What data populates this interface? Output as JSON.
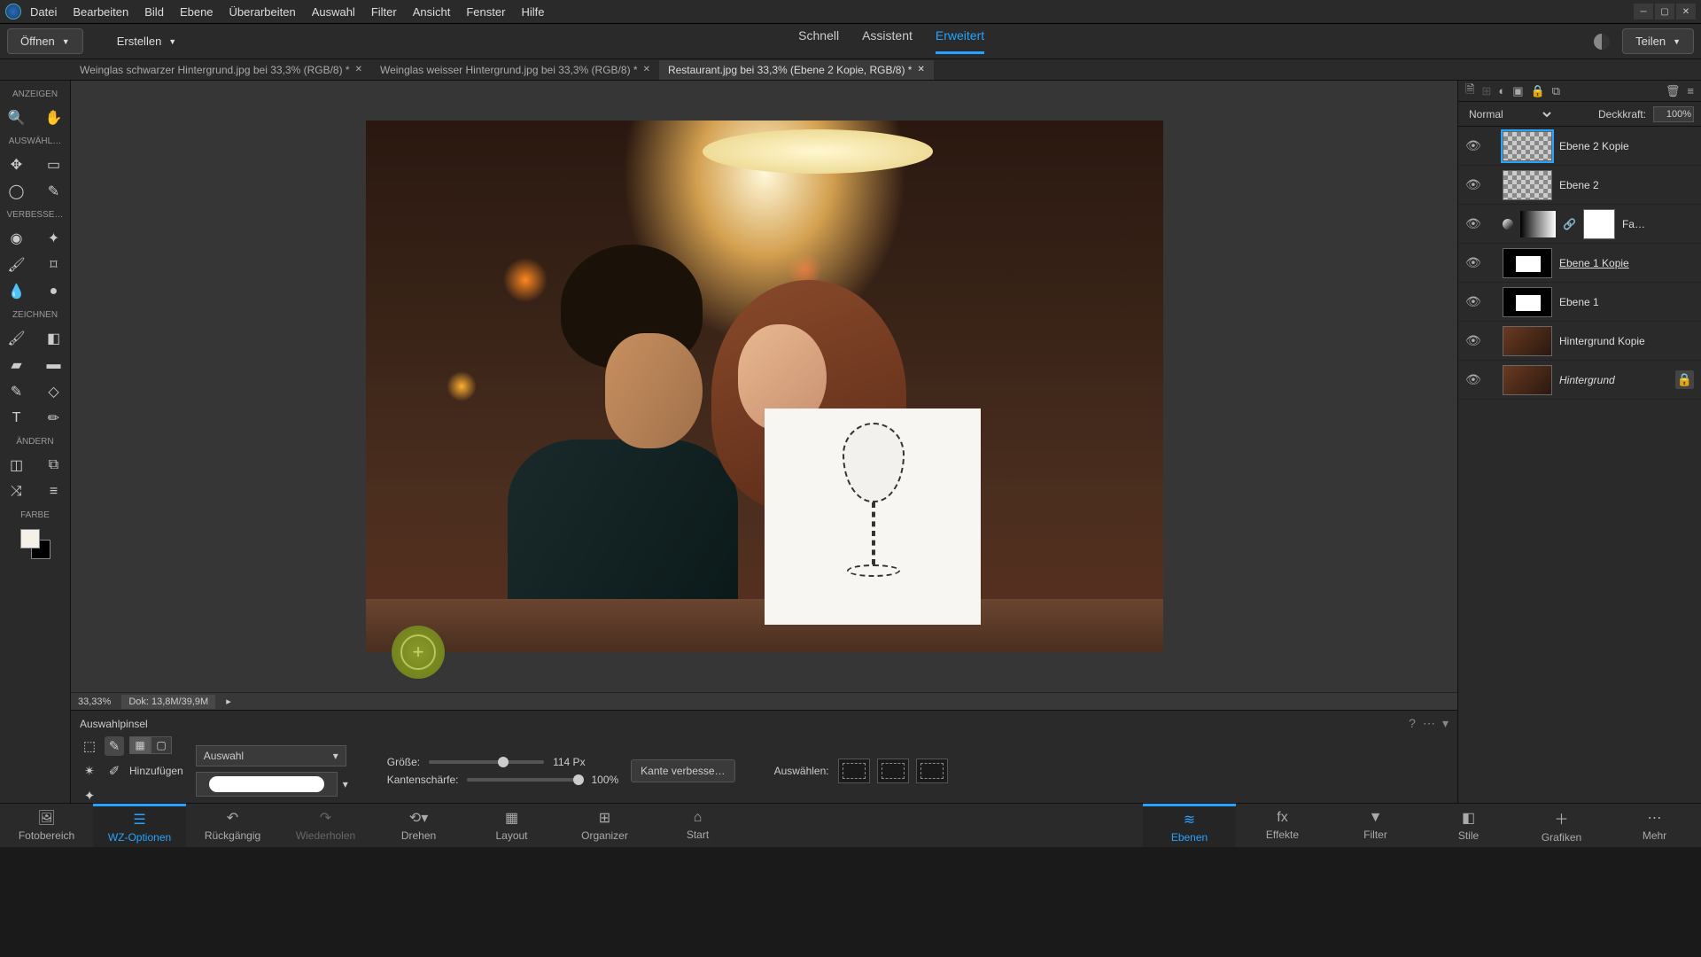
{
  "menus": [
    "Datei",
    "Bearbeiten",
    "Bild",
    "Ebene",
    "Überarbeiten",
    "Auswahl",
    "Filter",
    "Ansicht",
    "Fenster",
    "Hilfe"
  ],
  "secbar": {
    "open": "Öffnen",
    "create": "Erstellen",
    "share": "Teilen"
  },
  "modes": {
    "quick": "Schnell",
    "guided": "Assistent",
    "expert": "Erweitert"
  },
  "tabs": [
    {
      "label": "Weinglas schwarzer Hintergrund.jpg bei 33,3% (RGB/8) *"
    },
    {
      "label": "Weinglas weisser Hintergrund.jpg bei 33,3% (RGB/8) *"
    },
    {
      "label": "Restaurant.jpg bei 33,3% (Ebene 2 Kopie, RGB/8) *"
    }
  ],
  "toolbox": {
    "anzeigen": "ANZEIGEN",
    "auswaehl": "AUSWÄHL…",
    "verbesse": "VERBESSE…",
    "zeichnen": "ZEICHNEN",
    "aendern": "ÄNDERN",
    "farbe": "FARBE"
  },
  "status": {
    "zoom": "33,33%",
    "doc": "Dok: 13,8M/39,9M"
  },
  "options": {
    "title": "Auswahlpinsel",
    "mode": "Auswahl",
    "add": "Hinzufügen",
    "size_label": "Größe:",
    "size_val": "114 Px",
    "edge_label": "Kantenschärfe:",
    "edge_val": "100%",
    "refine": "Kante verbesse…",
    "select": "Auswählen:"
  },
  "blend": {
    "mode": "Normal",
    "opacity_label": "Deckkraft:",
    "opacity": "100%"
  },
  "layers": [
    {
      "name": "Ebene 2 Kopie",
      "type": "checker",
      "sel": true
    },
    {
      "name": "Ebene 2",
      "type": "checker"
    },
    {
      "name": "Fa…",
      "type": "levels",
      "mask": true
    },
    {
      "name": "Ebene 1 Kopie ",
      "type": "dark",
      "underline": true
    },
    {
      "name": "Ebene 1",
      "type": "dark"
    },
    {
      "name": "Hintergrund Kopie",
      "type": "photo"
    },
    {
      "name": "Hintergrund",
      "type": "photo",
      "italic": true,
      "locked": true
    }
  ],
  "bottom": {
    "foto": "Fotobereich",
    "wz": "WZ-Optionen",
    "undo": "Rückgängig",
    "redo": "Wiederholen",
    "rotate": "Drehen",
    "layout": "Layout",
    "organizer": "Organizer",
    "home": "Start",
    "ebenen": "Ebenen",
    "effekte": "Effekte",
    "filter": "Filter",
    "stile": "Stile",
    "grafiken": "Grafiken",
    "mehr": "Mehr"
  }
}
